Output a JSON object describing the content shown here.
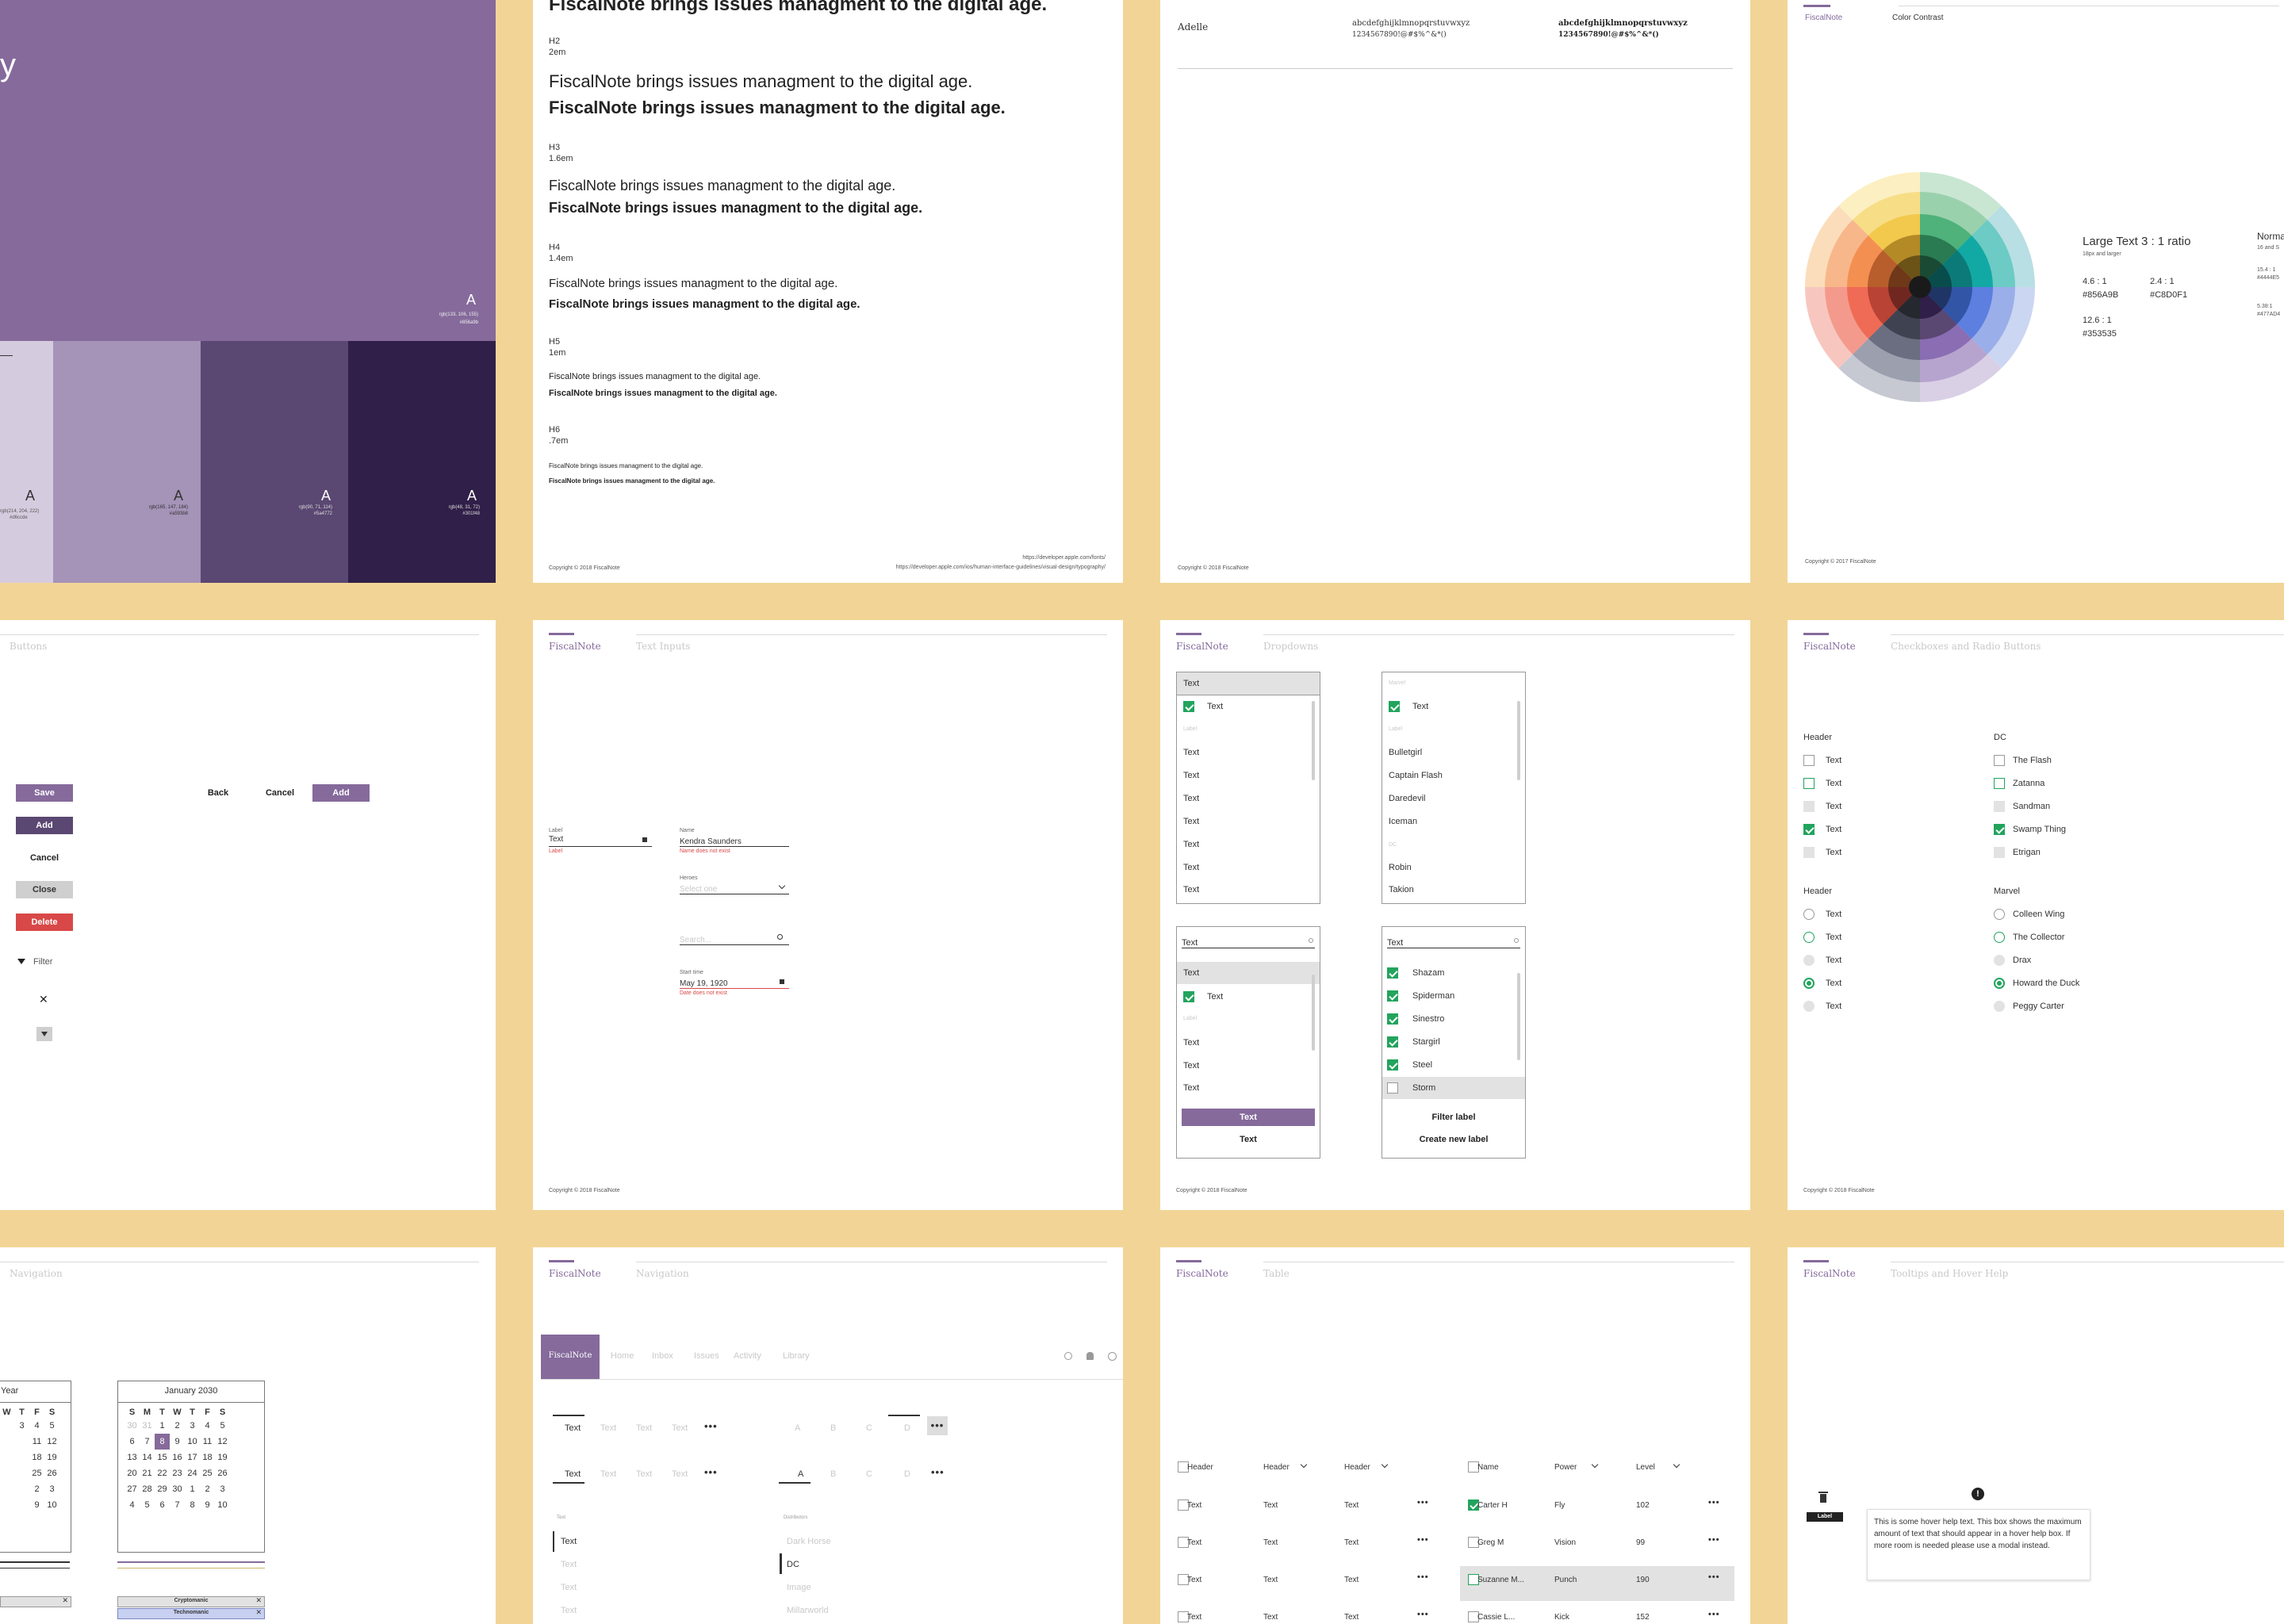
{
  "colors": {
    "background": "#f2d596",
    "brand": "#856a9b",
    "purple_light": "#d5cbde",
    "purple_mid": "#a593b8",
    "purple_dark": "#5a4772",
    "purple_darkest": "#301f48",
    "green": "#22a45d",
    "red": "#d94848"
  },
  "palette": {
    "big_label": "A",
    "big_title_fragment": "y",
    "big_caption_line1": "rgb(133, 106, 155)",
    "big_caption_line2": "#856a9b",
    "swatches": [
      {
        "label": "A",
        "caption1": "rgb(214, 204, 222)",
        "caption2": "#d6ccde"
      },
      {
        "label": "A",
        "caption1": "rgb(165, 147, 184)",
        "caption2": "#a593b8"
      },
      {
        "label": "A",
        "caption1": "rgb(90, 71, 114)",
        "caption2": "#5a4772"
      },
      {
        "label": "A",
        "caption1": "rgb(48, 31, 72)",
        "caption2": "#301f48"
      }
    ]
  },
  "typography": {
    "h1_sample": "FiscalNote brings issues managment to the digital age.",
    "levels": [
      {
        "name": "H2",
        "size": "2em",
        "regular": "FiscalNote brings issues managment to the digital age.",
        "bold": "FiscalNote brings issues managment to the digital age."
      },
      {
        "name": "H3",
        "size": "1.6em",
        "regular": "FiscalNote brings issues managment to the digital age.",
        "bold": "FiscalNote brings issues managment to the digital age."
      },
      {
        "name": "H4",
        "size": "1.4em",
        "regular": "FiscalNote brings issues managment to the digital age.",
        "bold": "FiscalNote brings issues managment to the digital age."
      },
      {
        "name": "H5",
        "size": "1em",
        "regular": "FiscalNote brings issues managment to the digital age.",
        "bold": "FiscalNote brings issues managment to the digital age."
      },
      {
        "name": "H6",
        "size": ".7em",
        "regular": "FiscalNote brings issues managment to the digital age.",
        "bold": "FiscalNote brings issues managment to the digital age."
      }
    ],
    "copyright": "Copyright © 2018 FiscalNote",
    "link1": "https://developer.apple.com/fonts/",
    "link2": "https://developer.apple.com/ios/human-interface-guidelines/visual-design/typography/"
  },
  "font_card": {
    "font_name": "Adelle",
    "glyphs_regular_1": "abcdefghijklmnopqrstuvwxyz",
    "glyphs_regular_2": "1234567890!@#$%^&*()",
    "glyphs_bold_1": "abcdefghijklmnopqrstuvwxyz",
    "glyphs_bold_2": "1234567890!@#$%^&*()",
    "copyright": "Copyright © 2018 FiscalNote"
  },
  "contrast": {
    "brand": "FiscalNote",
    "title": "Color Contrast",
    "large_text": "Large Text 3 : 1 ratio",
    "large_sub": "18px and larger",
    "normal_fragment": "Norma",
    "normal_sub": "16 and S",
    "ratios": [
      {
        "ratio": "4.6 : 1",
        "hex": "#856A9B"
      },
      {
        "ratio": "2.4 : 1",
        "hex": "#C8D0F1"
      },
      {
        "ratio": "12.6 : 1",
        "hex": "#353535"
      }
    ],
    "side_ratio1": "15.4 : 1",
    "side_hex1": "#4444E5",
    "side_ratio2": "5.38:1",
    "side_hex2": "#477AD4",
    "copyright": "Copyright © 2017 FiscalNote"
  },
  "buttons": {
    "section": "Buttons",
    "save": "Save",
    "add": "Add",
    "cancel": "Cancel",
    "close": "Close",
    "delete": "Delete",
    "filter": "Filter",
    "back": "Back",
    "cancel2": "Cancel",
    "add2": "Add"
  },
  "text_inputs": {
    "brand": "FiscalNote",
    "section": "Text Inputs",
    "label1": "Label",
    "value1": "Text",
    "error1": "Label",
    "name_label": "Name",
    "name_value": "Kendra Saunders",
    "name_error": "Name does not exist",
    "heroes_label": "Heroes",
    "select_placeholder": "Select one",
    "search_placeholder": "Search...",
    "start_label": "Start time",
    "start_value": "May 19, 1920",
    "start_error": "Date does not exist",
    "copyright": "Copyright © 2018 FiscalNote"
  },
  "dropdowns": {
    "brand": "FiscalNote",
    "section": "Dropdowns",
    "box1": {
      "header": "Text",
      "checked_item": "Text",
      "group": "Label",
      "items": [
        "Text",
        "Text",
        "Text",
        "Text",
        "Text",
        "Text",
        "Text"
      ]
    },
    "box2": {
      "header": "Marvel",
      "checked_item": "Text",
      "group": "Label",
      "items": [
        "Bulletgirl",
        "Captain Flash",
        "Daredevil",
        "Iceman"
      ],
      "group2": "DC",
      "items2": [
        "Robin",
        "Takion"
      ]
    },
    "box3": {
      "input": "Text",
      "highlight": "Text",
      "checked_item": "Text",
      "group": "Label",
      "items": [
        "Text",
        "Text",
        "Text"
      ],
      "primary": "Text",
      "secondary": "Text"
    },
    "box4": {
      "input": "Text",
      "checked": [
        "Shazam",
        "Spiderman",
        "Sinestro",
        "Stargirl",
        "Steel"
      ],
      "unchecked": "Storm",
      "filter_label": "Filter label",
      "create_label": "Create new label"
    },
    "copyright": "Copyright © 2018 FiscalNote"
  },
  "checkboxes": {
    "brand": "FiscalNote",
    "section": "Checkboxes and Radio Buttons",
    "col1_header": "Header",
    "col1_items": [
      "Text",
      "Text",
      "Text",
      "Text",
      "Text"
    ],
    "col2_header": "DC",
    "col2_items": [
      "The Flash",
      "Zatanna",
      "Sandman",
      "Swamp Thing",
      "Etrigan"
    ],
    "col3_header": "Header",
    "col3_items": [
      "Text",
      "Text",
      "Text",
      "Text",
      "Text"
    ],
    "col4_header": "Marvel",
    "col4_items": [
      "Colleen Wing",
      "The Collector",
      "Drax",
      "Howard the Duck",
      "Peggy Carter"
    ],
    "copyright": "Copyright © 2018 FiscalNote"
  },
  "navigation1": {
    "section": "Navigation",
    "cal1_title": "Year",
    "cal1_days": [
      "W",
      "T",
      "F",
      "S"
    ],
    "cal1_rows": [
      [
        "3",
        "4",
        "5"
      ],
      [
        "11",
        "12"
      ],
      [
        "18",
        "19"
      ],
      [
        "25",
        "26"
      ],
      [
        "2",
        "3"
      ],
      [
        "9",
        "10"
      ]
    ],
    "cal2_title": "January 2030",
    "cal2_days": [
      "S",
      "M",
      "T",
      "W",
      "T",
      "F",
      "S"
    ],
    "cal2_rows": [
      [
        "30",
        "31",
        "1",
        "2",
        "3",
        "4",
        "5"
      ],
      [
        "6",
        "7",
        "8",
        "9",
        "10",
        "11",
        "12"
      ],
      [
        "13",
        "14",
        "15",
        "16",
        "17",
        "18",
        "19"
      ],
      [
        "20",
        "21",
        "22",
        "23",
        "24",
        "25",
        "26"
      ],
      [
        "27",
        "28",
        "29",
        "30",
        "1",
        "2",
        "3"
      ],
      [
        "4",
        "5",
        "6",
        "7",
        "8",
        "9",
        "10"
      ]
    ],
    "tag1": "Cryptomanic",
    "tag2": "Technomanic"
  },
  "navigation2": {
    "brand": "FiscalNote",
    "section": "Navigation",
    "nav_brand": "FiscalNote",
    "nav_items": [
      "Home",
      "Inbox",
      "Issues",
      "Activity",
      "Library"
    ],
    "tabs_row1": [
      "Text",
      "Text",
      "Text",
      "Text"
    ],
    "tabs_row2": [
      "Text",
      "Text",
      "Text",
      "Text"
    ],
    "letters_row1": [
      "A",
      "B",
      "C",
      "D"
    ],
    "letters_row2": [
      "A",
      "B",
      "C",
      "D"
    ],
    "vert_header": "Text",
    "vert_items": [
      "Text",
      "Text",
      "Text",
      "Text"
    ],
    "dist_header": "Distributors",
    "dist_items": [
      "Dark Horse",
      "DC",
      "Image",
      "Millarworld"
    ]
  },
  "table": {
    "brand": "FiscalNote",
    "section": "Table",
    "left_headers": [
      "Header",
      "Header",
      "Header"
    ],
    "left_rows": [
      [
        "Text",
        "Text",
        "Text"
      ],
      [
        "Text",
        "Text",
        "Text"
      ],
      [
        "Text",
        "Text",
        "Text"
      ],
      [
        "Text",
        "Text",
        "Text"
      ]
    ],
    "right_headers": [
      "Name",
      "Power",
      "Level"
    ],
    "right_rows": [
      [
        "Carter H",
        "Fly",
        "102"
      ],
      [
        "Greg M",
        "Vision",
        "99"
      ],
      [
        "Suzanne M...",
        "Punch",
        "190"
      ],
      [
        "Cassie L...",
        "Kick",
        "152"
      ]
    ]
  },
  "tooltips": {
    "brand": "FiscalNote",
    "section": "Tooltips and Hover Help",
    "label": "Label",
    "help_text": "This is some hover help text. This box shows the maximum amount of text that should appear in a hover help box. If more room is needed please use a modal instead."
  }
}
